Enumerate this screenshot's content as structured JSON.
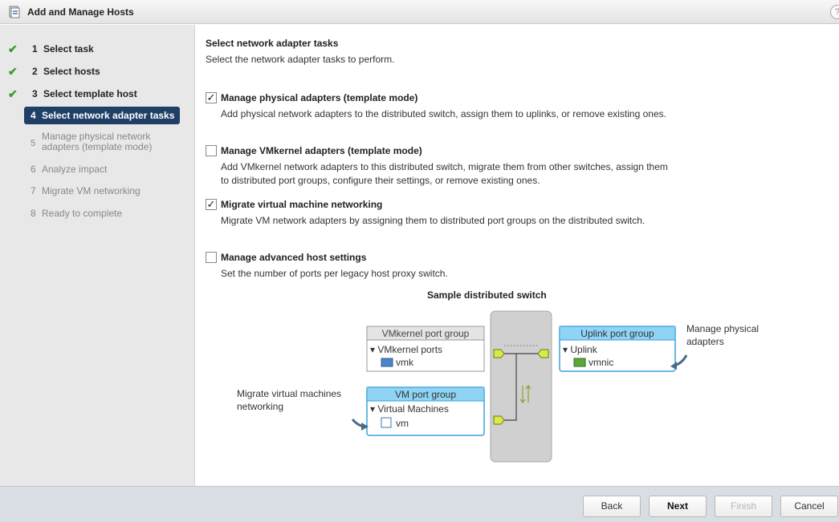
{
  "window": {
    "title": "Add and Manage Hosts",
    "help": "?"
  },
  "sidebar": {
    "steps": [
      {
        "num": "1",
        "label": "Select task",
        "state": "done"
      },
      {
        "num": "2",
        "label": "Select hosts",
        "state": "done"
      },
      {
        "num": "3",
        "label": "Select template host",
        "state": "done"
      },
      {
        "num": "4",
        "label": "Select network adapter tasks",
        "state": "active"
      },
      {
        "num": "5",
        "label": "Manage physical network adapters (template mode)",
        "state": "pending"
      },
      {
        "num": "6",
        "label": "Analyze impact",
        "state": "pending"
      },
      {
        "num": "7",
        "label": "Migrate VM networking",
        "state": "pending"
      },
      {
        "num": "8",
        "label": "Ready to complete",
        "state": "pending"
      }
    ]
  },
  "main": {
    "title": "Select network adapter tasks",
    "subtitle": "Select the network adapter tasks to perform.",
    "options": [
      {
        "label": "Manage physical adapters (template mode)",
        "checked": true,
        "desc": "Add physical network adapters to the distributed switch, assign them to uplinks, or remove existing ones."
      },
      {
        "label": "Manage VMkernel adapters (template mode)",
        "checked": false,
        "desc": "Add VMkernel network adapters to this distributed switch, migrate them from other switches, assign them to distributed port groups, configure their settings, or remove existing ones."
      },
      {
        "label": "Migrate virtual machine networking",
        "checked": true,
        "desc": "Migrate VM network adapters by assigning them to distributed port groups on the distributed switch."
      },
      {
        "label": "Manage advanced host settings",
        "checked": false,
        "desc": "Set the number of ports per legacy host proxy switch."
      }
    ],
    "check_mark": "✓"
  },
  "diagram": {
    "title": "Sample distributed switch",
    "vmkernel_group": "VMkernel port group",
    "vmkernel_ports": "▾ VMkernel ports",
    "vmk": "vmk",
    "vm_group": "VM port group",
    "virtual_machines": "▾ Virtual Machines",
    "vm": "vm",
    "uplink_group": "Uplink port group",
    "uplink": "▾ Uplink",
    "vmnic": "vmnic",
    "callout_physical_1": "Manage physical",
    "callout_physical_2": "adapters",
    "callout_migrate_1": "Migrate virtual machines",
    "callout_migrate_2": "networking",
    "colors": {
      "highlight": "#8fd3f5",
      "switch": "#d0d0d0",
      "port": "#d9e84a"
    }
  },
  "footer": {
    "back": "Back",
    "next": "Next",
    "finish": "Finish",
    "cancel": "Cancel"
  }
}
